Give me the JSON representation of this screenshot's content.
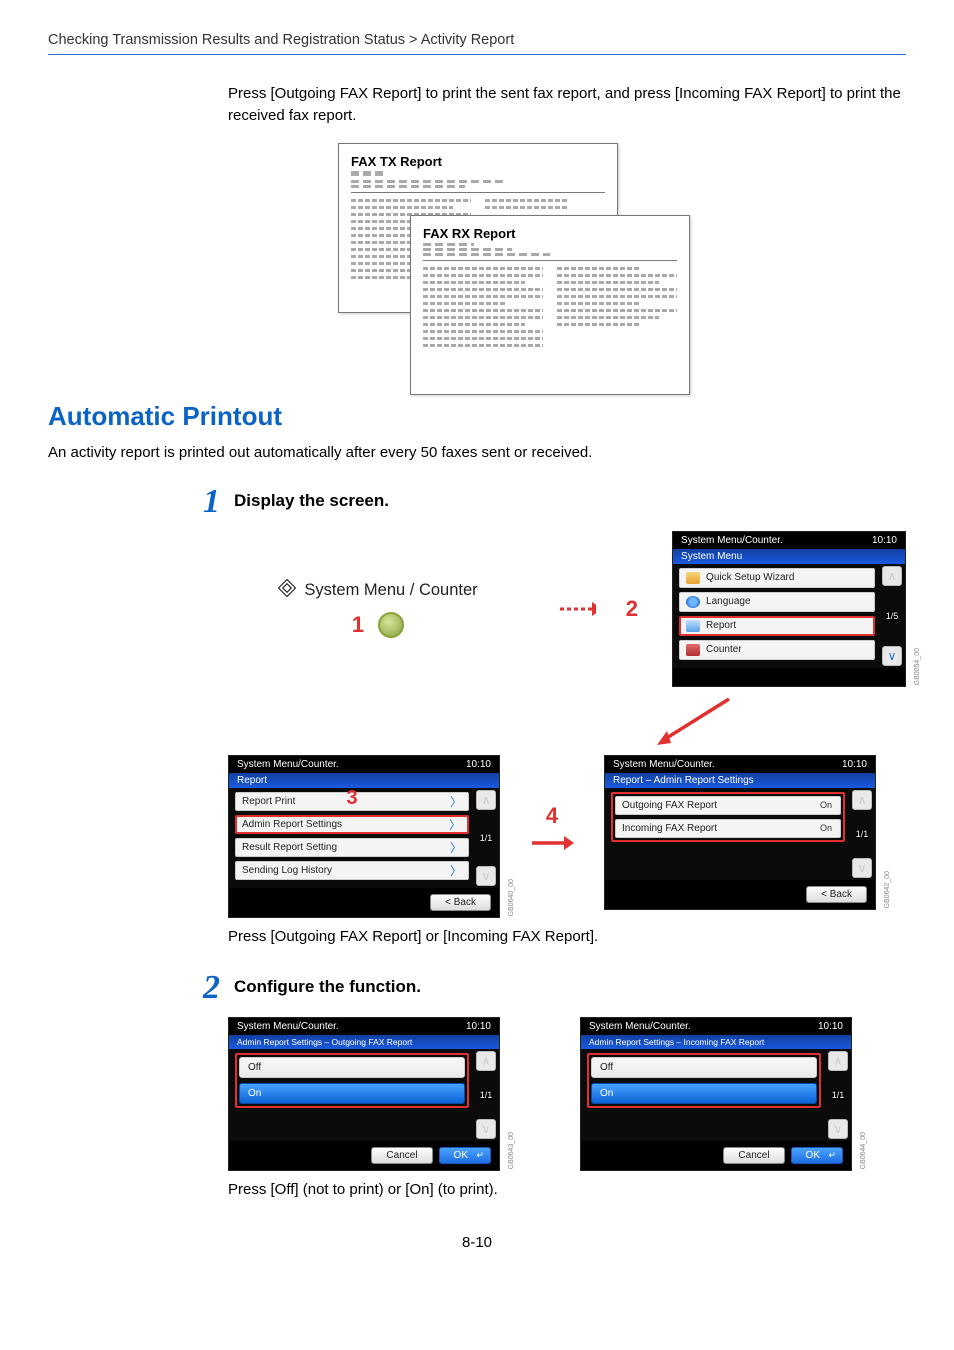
{
  "breadcrumb": "Checking Transmission Results and Registration Status > Activity Report",
  "intro": "Press [Outgoing FAX Report] to print the sent fax report, and press [Incoming FAX Report] to print the received fax report.",
  "reports": {
    "tx_title": "FAX TX Report",
    "rx_title": "FAX RX Report"
  },
  "section_title": "Automatic Printout",
  "section_body": "An activity report is printed out automatically after every 50 faxes sent or received.",
  "step1": {
    "num": "1",
    "label": "Display the screen."
  },
  "step2": {
    "num": "2",
    "label": "Configure the function."
  },
  "hw": {
    "label": "System Menu / Counter",
    "callout1": "1",
    "callout2": "2",
    "callout3": "3",
    "callout4": "4"
  },
  "top_panel": {
    "header": "System Menu/Counter.",
    "time": "10:10",
    "strip": "System Menu",
    "items": {
      "wizard": "Quick Setup Wizard",
      "language": "Language",
      "report": "Report",
      "counter": "Counter"
    },
    "pager": "1/5",
    "side_code": "GB0054_00"
  },
  "report_panel": {
    "header": "System Menu/Counter.",
    "time": "10:10",
    "strip": "Report",
    "items": {
      "print": "Report Print",
      "admin": "Admin Report Settings",
      "result": "Result Report Setting",
      "log": "Sending Log History"
    },
    "pager": "1/1",
    "back": "< Back",
    "side_code": "GB0640_00"
  },
  "admin_panel": {
    "header": "System Menu/Counter.",
    "time": "10:10",
    "strip": "Report – Admin Report Settings",
    "items": {
      "out": "Outgoing FAX Report",
      "out_state": "On",
      "in": "Incoming FAX Report",
      "in_state": "On"
    },
    "pager": "1/1",
    "back": "< Back",
    "side_code": "GB0642_00"
  },
  "out_cfg": {
    "header": "System Menu/Counter.",
    "time": "10:10",
    "strip": "Admin Report Settings – Outgoing FAX Report",
    "off": "Off",
    "on": "On",
    "pager": "1/1",
    "cancel": "Cancel",
    "ok": "OK",
    "side_code": "GB0643_00"
  },
  "in_cfg": {
    "header": "System Menu/Counter.",
    "time": "10:10",
    "strip": "Admin Report Settings – Incoming FAX Report",
    "off": "Off",
    "on": "On",
    "pager": "1/1",
    "cancel": "Cancel",
    "ok": "OK",
    "side_code": "GB0644_00"
  },
  "caption1": "Press [Outgoing FAX Report] or [Incoming FAX Report].",
  "caption2": "Press [Off] (not to print) or [On] (to print).",
  "page_num": "8-10"
}
